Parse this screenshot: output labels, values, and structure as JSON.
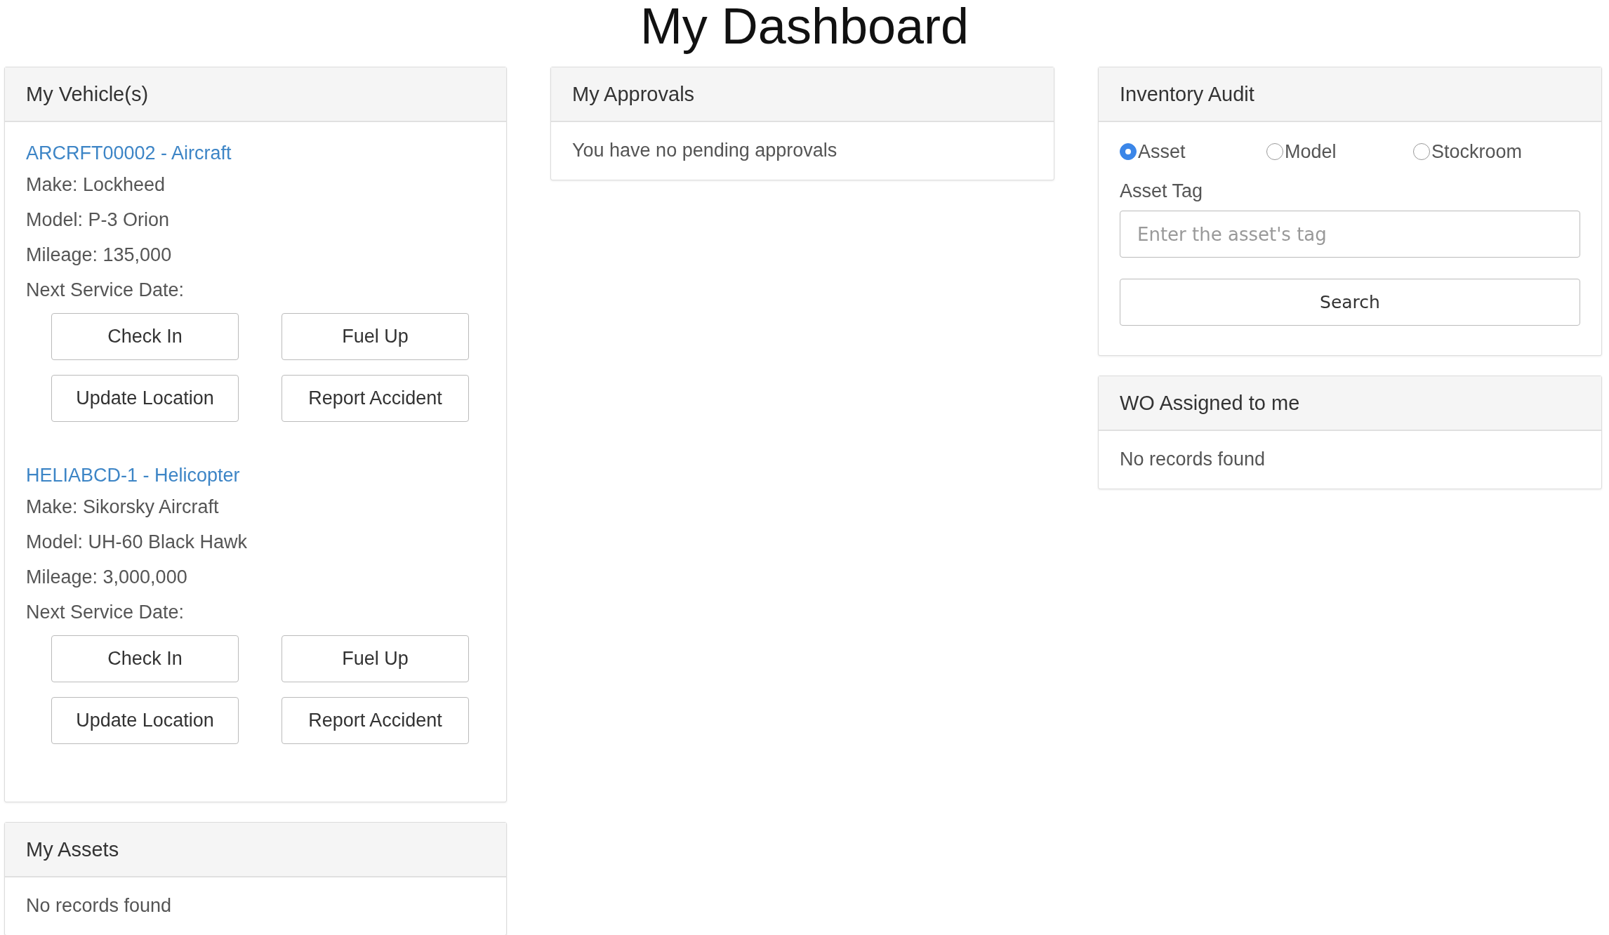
{
  "title": "My Dashboard",
  "vehicles_panel": {
    "title": "My Vehicle(s)",
    "vehicles": [
      {
        "link": "ARCRFT00002 - Aircraft",
        "details": [
          "Make: Lockheed",
          "Model: P-3 Orion",
          "Mileage: 135,000",
          "Next Service Date:"
        ],
        "buttons": [
          "Check In",
          "Fuel Up",
          "Update Location",
          "Report Accident"
        ]
      },
      {
        "link": "HELIABCD-1 - Helicopter",
        "details": [
          "Make: Sikorsky Aircraft",
          "Model: UH-60 Black Hawk",
          "Mileage: 3,000,000",
          "Next Service Date:"
        ],
        "buttons": [
          "Check In",
          "Fuel Up",
          "Update Location",
          "Report Accident"
        ]
      }
    ]
  },
  "assets_panel": {
    "title": "My Assets",
    "message": "No records found"
  },
  "approvals_panel": {
    "title": "My Approvals",
    "message": "You have no pending approvals"
  },
  "audit_panel": {
    "title": "Inventory Audit",
    "options": [
      {
        "label": "Asset",
        "selected": true
      },
      {
        "label": "Model",
        "selected": false
      },
      {
        "label": "Stockroom",
        "selected": false
      }
    ],
    "field_label": "Asset Tag",
    "field": {
      "placeholder": "Enter the asset's tag"
    },
    "button": "Search"
  },
  "wo_panel": {
    "title": "WO Assigned to me",
    "message": "No records found"
  }
}
